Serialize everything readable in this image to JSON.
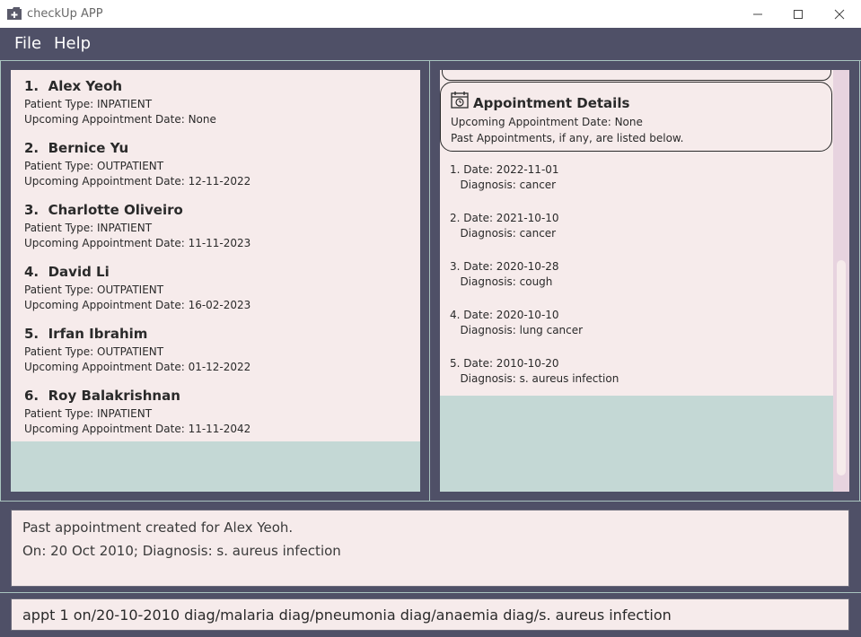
{
  "window": {
    "title": "checkUp APP",
    "icon": "folder-plus-icon",
    "controls": [
      "minimize-icon",
      "maximize-icon",
      "close-icon"
    ]
  },
  "menu": {
    "file": "File",
    "help": "Help"
  },
  "patients": [
    {
      "index": "1.",
      "name": "Alex Yeoh",
      "type": "Patient Type: INPATIENT",
      "appt": "Upcoming Appointment Date: None"
    },
    {
      "index": "2.",
      "name": "Bernice Yu",
      "type": "Patient Type: OUTPATIENT",
      "appt": "Upcoming Appointment Date: 12-11-2022"
    },
    {
      "index": "3.",
      "name": "Charlotte Oliveiro",
      "type": "Patient Type: INPATIENT",
      "appt": "Upcoming Appointment Date: 11-11-2023"
    },
    {
      "index": "4.",
      "name": "David Li",
      "type": "Patient Type: OUTPATIENT",
      "appt": "Upcoming Appointment Date: 16-02-2023"
    },
    {
      "index": "5.",
      "name": "Irfan Ibrahim",
      "type": "Patient Type: OUTPATIENT",
      "appt": "Upcoming Appointment Date: 01-12-2022"
    },
    {
      "index": "6.",
      "name": "Roy Balakrishnan",
      "type": "Patient Type: INPATIENT",
      "appt": "Upcoming Appointment Date: 11-11-2042"
    }
  ],
  "details": {
    "icon": "calendar-clock-icon",
    "title": "Appointment Details",
    "upcoming": "Upcoming Appointment Date: None",
    "past_note": "Past Appointments, if any, are listed below."
  },
  "past_appointments": [
    {
      "date": "1. Date: 2022-11-01",
      "diagnosis": "   Diagnosis: cancer"
    },
    {
      "date": "2. Date: 2021-10-10",
      "diagnosis": "   Diagnosis: cancer"
    },
    {
      "date": "3. Date: 2020-10-28",
      "diagnosis": "   Diagnosis: cough"
    },
    {
      "date": "4. Date: 2020-10-10",
      "diagnosis": "   Diagnosis: lung cancer"
    },
    {
      "date": "5. Date: 2010-10-20",
      "diagnosis": "   Diagnosis: s. aureus infection"
    }
  ],
  "result": {
    "line1": "Past appointment created for Alex Yeoh.",
    "line2": "On: 20 Oct 2010; Diagnosis: s. aureus infection"
  },
  "command": {
    "value": "appt 1 on/20-10-2010 diag/malaria diag/pneumonia diag/anaemia diag/s. aureus infection"
  },
  "colors": {
    "background": "#4f5067",
    "card": "#f6ebeb",
    "pane_fill": "#c4d8d5",
    "scrollbar_track": "#e7d3df"
  }
}
